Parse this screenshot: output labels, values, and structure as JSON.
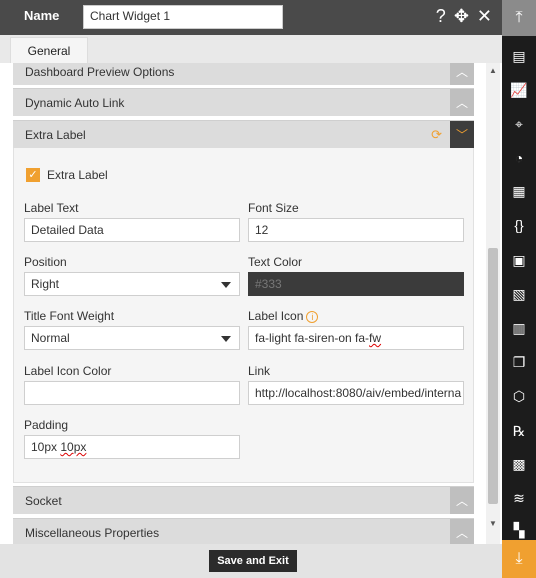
{
  "header": {
    "name_label": "Name",
    "name_value": "Chart Widget 1",
    "icons": [
      "help-icon",
      "move-icon",
      "close-icon"
    ]
  },
  "tabs": [
    {
      "label": "General"
    }
  ],
  "sections": {
    "dashboard_preview": {
      "title": "Dashboard Preview Options"
    },
    "dynamic_auto_link": {
      "title": "Dynamic Auto Link"
    },
    "extra_label": {
      "title": "Extra Label"
    },
    "socket": {
      "title": "Socket"
    },
    "misc": {
      "title": "Miscellaneous Properties"
    }
  },
  "extra_label": {
    "checkbox_label": "Extra Label",
    "checked": true,
    "label_text": {
      "label": "Label Text",
      "value": "Detailed Data"
    },
    "font_size": {
      "label": "Font Size",
      "value": "12"
    },
    "position": {
      "label": "Position",
      "value": "Right"
    },
    "text_color": {
      "label": "Text Color",
      "placeholder": "#333"
    },
    "title_font_weight": {
      "label": "Title Font Weight",
      "value": "Normal"
    },
    "label_icon": {
      "label": "Label Icon",
      "value_prefix": "fa-light fa-siren-on fa-",
      "value_suffix": "fw"
    },
    "label_icon_color": {
      "label": "Label Icon Color",
      "value": ""
    },
    "link": {
      "label": "Link",
      "value": "http://localhost:8080/aiv/embed/interna"
    },
    "padding": {
      "label": "Padding",
      "value_prefix": "10px ",
      "value_suffix": "10px"
    }
  },
  "footer": {
    "save_label": "Save and Exit"
  },
  "colors": {
    "accent": "#f0a030",
    "header_bg": "#4a4a4a",
    "toolbar_bg": "#1c1c1c"
  },
  "toolbar_icons": [
    "collapse-top-icon",
    "table-icon",
    "chart-icon",
    "map-icon",
    "report-icon",
    "document-icon",
    "code-icon",
    "image-icon",
    "spreadsheet-icon",
    "bar-chart-icon",
    "copy-icon",
    "cubes-icon",
    "rx-icon",
    "save-icon",
    "layers-icon",
    "grid-icon",
    "download-icon"
  ]
}
